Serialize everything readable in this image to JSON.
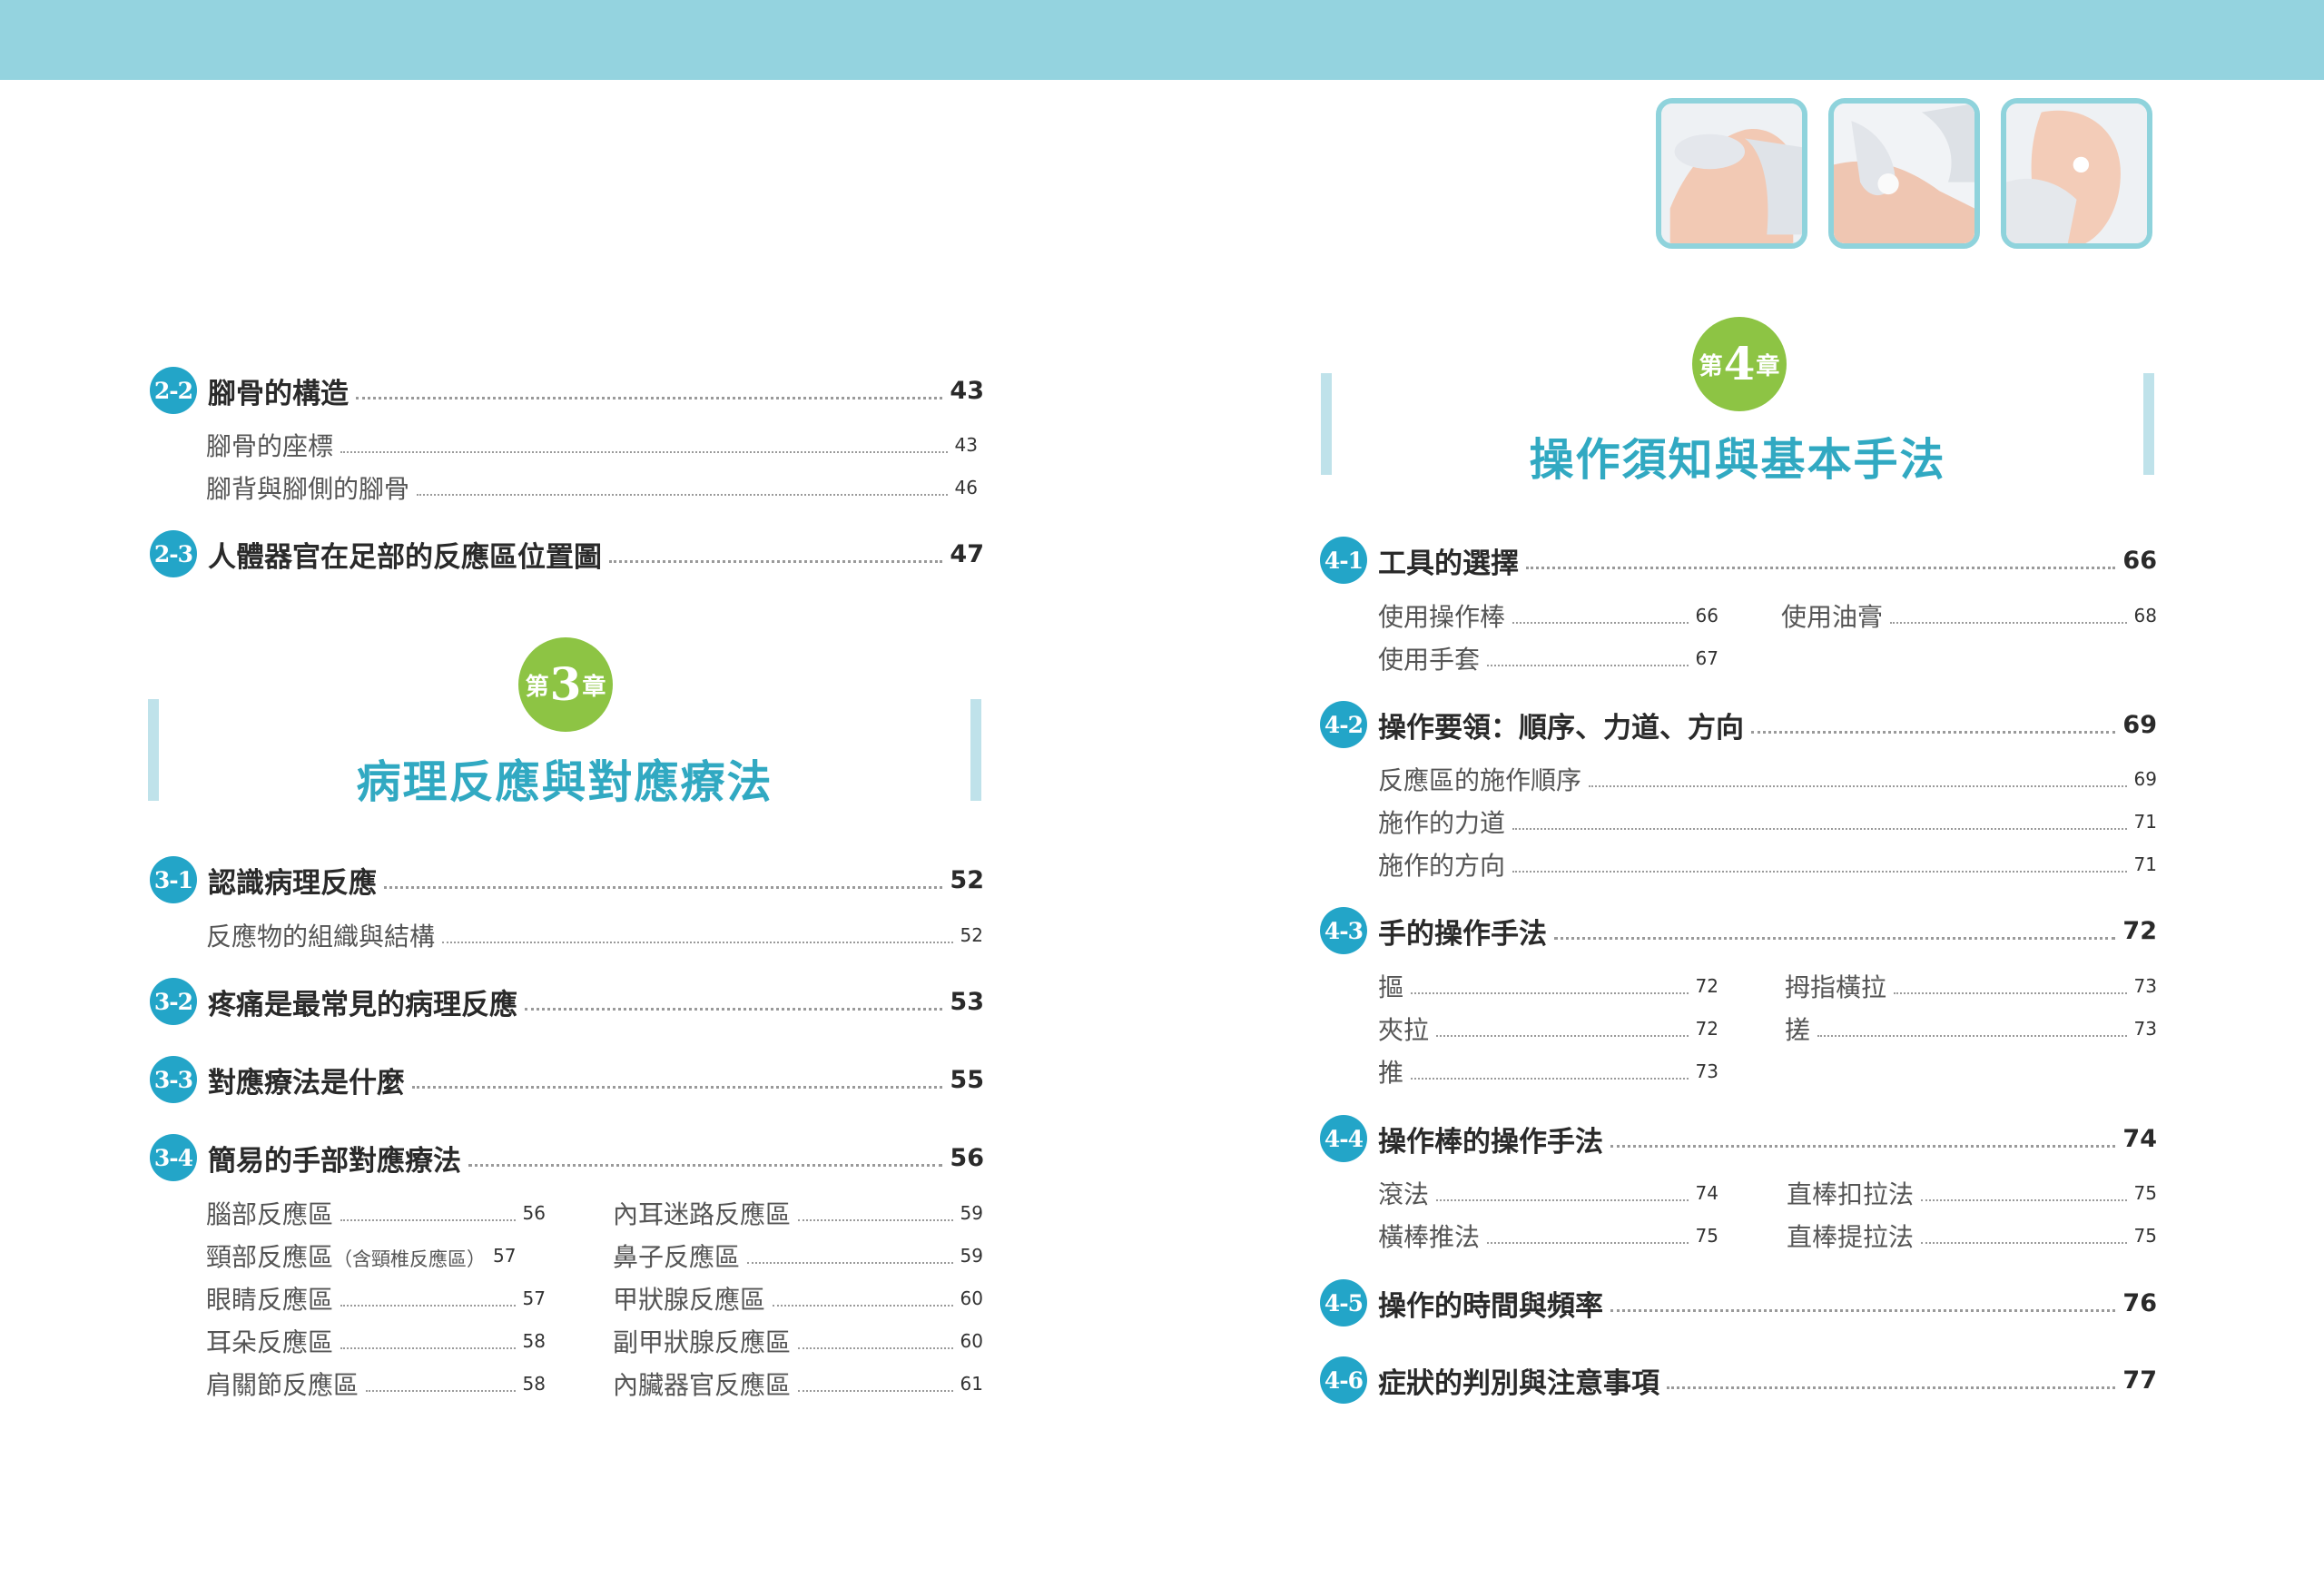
{
  "colors": {
    "band": "#94d3df",
    "accent": "#31a9c2",
    "badge": "#23a5c8",
    "chapter_badge": "#8dc444"
  },
  "photos": [
    {
      "name": "foot-massage-photo-1"
    },
    {
      "name": "foot-massage-photo-2"
    },
    {
      "name": "foot-massage-photo-3"
    }
  ],
  "left": {
    "sections_top": [
      {
        "num": "2-2",
        "title": "腳骨的構造",
        "page": "43",
        "subs": [
          {
            "title": "腳骨的座標",
            "page": "43"
          },
          {
            "title": "腳背與腳側的腳骨",
            "page": "46"
          }
        ]
      },
      {
        "num": "2-3",
        "title": "人體器官在足部的反應區位置圖",
        "page": "47",
        "subs": []
      }
    ],
    "chapter": {
      "prefix": "第",
      "number": "3",
      "suffix": "章",
      "title": "病理反應與對應療法"
    },
    "sections": [
      {
        "num": "3-1",
        "title": "認識病理反應",
        "page": "52",
        "subs": [
          {
            "title": "反應物的組織與結構",
            "page": "52"
          }
        ]
      },
      {
        "num": "3-2",
        "title": "疼痛是最常見的病理反應",
        "page": "53",
        "subs": []
      },
      {
        "num": "3-3",
        "title": "對應療法是什麼",
        "page": "55",
        "subs": []
      },
      {
        "num": "3-4",
        "title": "簡易的手部對應療法",
        "page": "56",
        "subs_left": [
          {
            "title": "腦部反應區",
            "page": "56"
          },
          {
            "title": "頸部反應區",
            "note": "（含頸椎反應區）",
            "page": "57"
          },
          {
            "title": "眼睛反應區",
            "page": "57"
          },
          {
            "title": "耳朵反應區",
            "page": "58"
          },
          {
            "title": "肩關節反應區",
            "page": "58"
          }
        ],
        "subs_right": [
          {
            "title": "內耳迷路反應區",
            "page": "59"
          },
          {
            "title": "鼻子反應區",
            "page": "59"
          },
          {
            "title": "甲狀腺反應區",
            "page": "60"
          },
          {
            "title": "副甲狀腺反應區",
            "page": "60"
          },
          {
            "title": "內臟器官反應區",
            "page": "61"
          }
        ]
      }
    ]
  },
  "right": {
    "chapter": {
      "prefix": "第",
      "number": "4",
      "suffix": "章",
      "title": "操作須知與基本手法"
    },
    "sections": [
      {
        "num": "4-1",
        "title": "工具的選擇",
        "page": "66",
        "subs_left": [
          {
            "title": "使用操作棒",
            "page": "66"
          },
          {
            "title": "使用手套",
            "page": "67"
          }
        ],
        "subs_right": [
          {
            "title": "使用油膏",
            "page": "68"
          }
        ]
      },
      {
        "num": "4-2",
        "title": "操作要領：順序、力道、方向",
        "page": "69",
        "subs": [
          {
            "title": "反應區的施作順序",
            "page": "69"
          },
          {
            "title": "施作的力道",
            "page": "71"
          },
          {
            "title": "施作的方向",
            "page": "71"
          }
        ]
      },
      {
        "num": "4-3",
        "title": "手的操作手法",
        "page": "72",
        "subs_left": [
          {
            "title": "摳",
            "page": "72"
          },
          {
            "title": "夾拉",
            "page": "72"
          },
          {
            "title": "推",
            "page": "73"
          }
        ],
        "subs_right": [
          {
            "title": "拇指橫拉",
            "page": "73"
          },
          {
            "title": "搓",
            "page": "73"
          }
        ]
      },
      {
        "num": "4-4",
        "title": "操作棒的操作手法",
        "page": "74",
        "subs_left": [
          {
            "title": "滾法",
            "page": "74"
          },
          {
            "title": "橫棒推法",
            "page": "75"
          }
        ],
        "subs_right": [
          {
            "title": "直棒扣拉法",
            "page": "75"
          },
          {
            "title": "直棒提拉法",
            "page": "75"
          }
        ]
      },
      {
        "num": "4-5",
        "title": "操作的時間與頻率",
        "page": "76",
        "subs": []
      },
      {
        "num": "4-6",
        "title": "症狀的判別與注意事項",
        "page": "77",
        "subs": []
      }
    ]
  }
}
